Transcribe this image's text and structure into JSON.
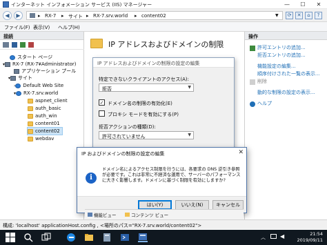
{
  "window": {
    "title": "インターネット インフォメーション サービス (IIS) マネージャー",
    "minimize": "—",
    "maximize": "☐",
    "close": "✕"
  },
  "address": {
    "crumbs": [
      "RX-7",
      "サイト",
      "RX-7.srv.world",
      "content02"
    ],
    "separator": "▸"
  },
  "menu": [
    "ファイル(F)",
    "表示(V)",
    "ヘルプ(H)"
  ],
  "connections": {
    "header": "接続",
    "tree": [
      {
        "label": "スタート ページ",
        "icon": "start-page-icon"
      },
      {
        "label": "RX-7 (RX-7¥Administrator)",
        "icon": "server-icon"
      },
      {
        "label": "アプリケーション プール",
        "icon": "app-pool-icon"
      },
      {
        "label": "サイト",
        "icon": "sites-folder-icon"
      },
      {
        "label": "Default Web Site",
        "icon": "globe-icon"
      },
      {
        "label": "RX-7.srv.world",
        "icon": "globe-icon"
      },
      {
        "label": "aspnet_client",
        "icon": "folder-icon"
      },
      {
        "label": "auth_basic",
        "icon": "folder-icon"
      },
      {
        "label": "auth_win",
        "icon": "folder-icon"
      },
      {
        "label": "content01",
        "icon": "folder-icon"
      },
      {
        "label": "content02",
        "icon": "folder-icon",
        "selected": true
      },
      {
        "label": "webdav",
        "icon": "folder-icon"
      }
    ]
  },
  "main": {
    "title": "IP アドレスおよびドメインの制限"
  },
  "actions": {
    "header": "操作",
    "items": [
      {
        "label": "許可エントリの追加...",
        "enabled": true
      },
      {
        "label": "拒否エントリの追加...",
        "enabled": true
      },
      {
        "label": "機能設定の編集...",
        "enabled": true
      },
      {
        "label": "順序付けされた一覧の表示...",
        "enabled": true
      },
      {
        "label": "削除",
        "enabled": false
      },
      {
        "label": "動的な制限の設定の表示...",
        "enabled": true
      },
      {
        "label": "ヘルプ",
        "enabled": true
      }
    ]
  },
  "settings_dialog": {
    "title": "IP アドレスおよびドメインの制限の設定の編集",
    "unspecified_access_label": "特定できないクライアントのアクセス(A):",
    "unspecified_access_value": "拒否",
    "enable_domain_label": "ドメイン名の制限の有効化(E)",
    "enable_domain_checked": true,
    "enable_proxy_label": "プロキシ モードを有効にする(P)",
    "enable_proxy_checked": false,
    "deny_action_label": "拒否アクションの種類(D):",
    "deny_action_value": "許可されていません"
  },
  "confirm_dialog": {
    "title": "IP およびドメインの制限の設定の編集",
    "message": "ドメイン名によるアクセス制限を行うには、各要求の DNS 逆引き参照が必要です。これは非常に不経済な運用で、サーバーのパフォーマンスに大きく影響します。ドメインに基づく制限を有効にしますか?",
    "yes": "はい(Y)",
    "no": "いいえ(N)",
    "cancel": "キャンセル"
  },
  "bottom_tabs": [
    "機能ビュー",
    "コンテンツ ビュー"
  ],
  "status": "構成: 'localhost' applicationHost.config , <場所のパス=\"RX-7.srv.world/content02\">",
  "clock": {
    "time": "21:54",
    "date": "2019/09/11"
  },
  "colors": {
    "accent": "#0078d7",
    "link": "#1f6fb6",
    "taskbar": "#101820"
  }
}
